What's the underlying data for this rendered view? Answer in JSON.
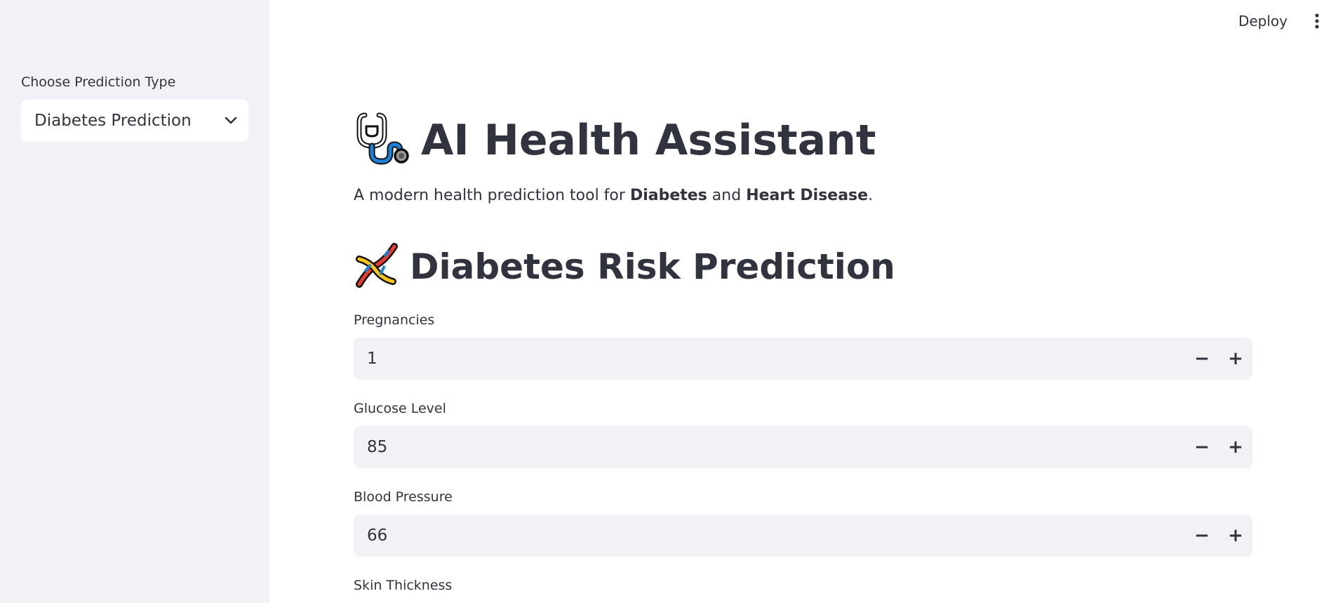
{
  "sidebar": {
    "select_label": "Choose Prediction Type",
    "select_value": "Diabetes Prediction"
  },
  "toolbar": {
    "deploy_label": "Deploy"
  },
  "header": {
    "title": "AI Health Assistant",
    "title_icon": "stethoscope-icon",
    "subtitle_prefix": "A modern health prediction tool for ",
    "subtitle_bold1": "Diabetes",
    "subtitle_mid": " and ",
    "subtitle_bold2": "Heart Disease",
    "subtitle_suffix": "."
  },
  "section": {
    "title": "Diabetes Risk Prediction",
    "title_icon": "dna-icon"
  },
  "fields": [
    {
      "label": "Pregnancies",
      "value": "1"
    },
    {
      "label": "Glucose Level",
      "value": "85"
    },
    {
      "label": "Blood Pressure",
      "value": "66"
    },
    {
      "label": "Skin Thickness",
      "value": ""
    }
  ],
  "stepper": {
    "minus": "−",
    "plus": "+"
  },
  "colors": {
    "sidebar_bg": "#f0f2f6",
    "input_bg": "#f0f2f6",
    "text": "#31333f"
  }
}
